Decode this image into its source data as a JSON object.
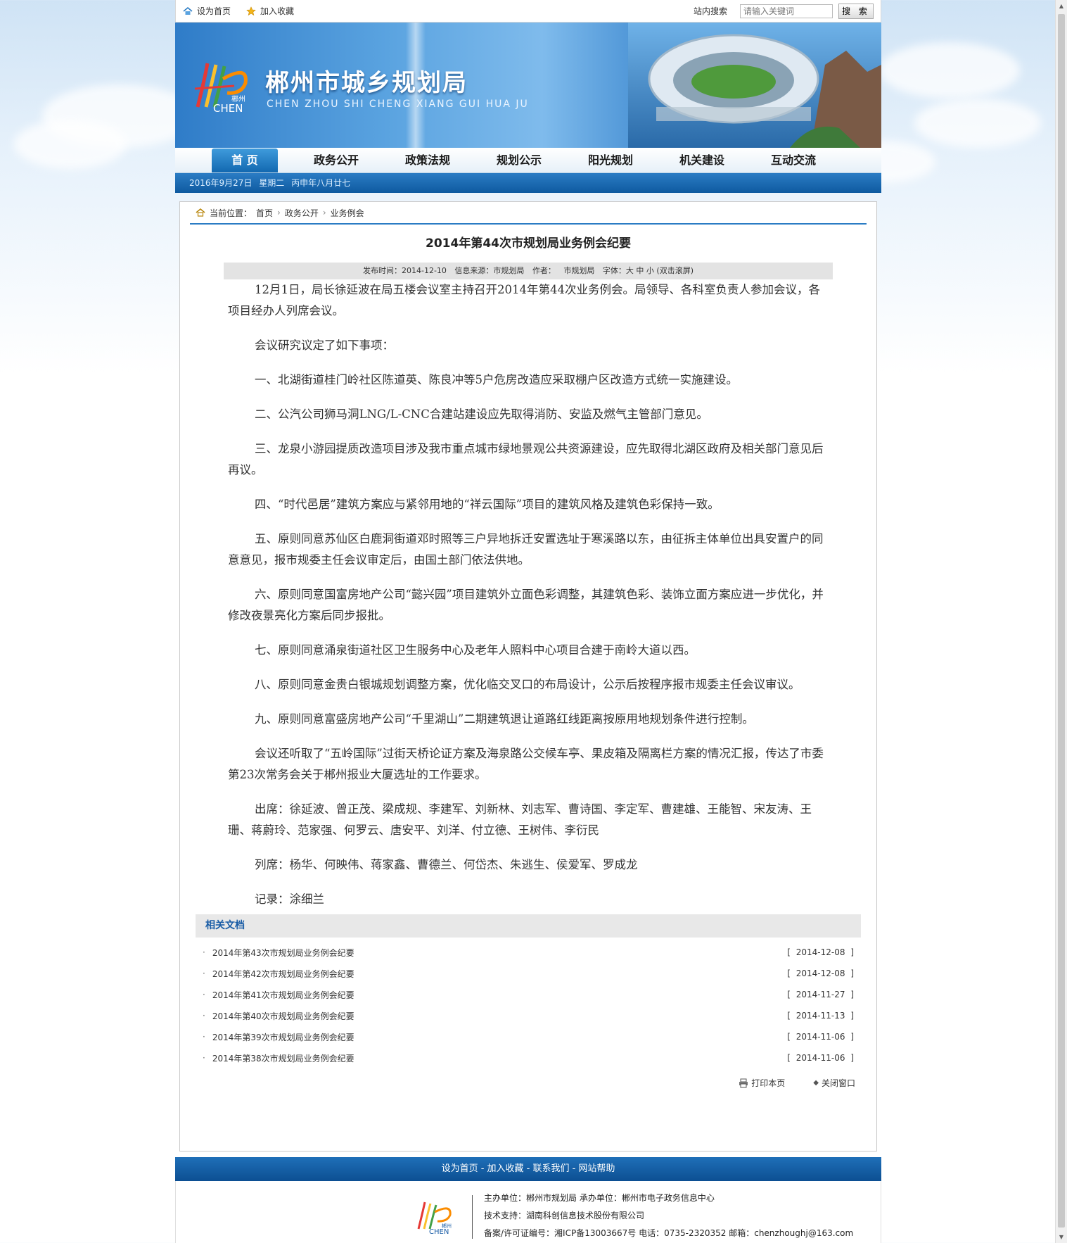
{
  "topbar": {
    "set_home": "设为首页",
    "add_fav": "加入收藏",
    "search_label": "站内搜索",
    "search_placeholder": "请输入关键词",
    "search_button": "搜 索"
  },
  "banner": {
    "title_cn": "郴州市城乡规划局",
    "title_en": "CHEN ZHOU SHI CHENG XIANG GUI HUA JU",
    "logo_text_small": "郴州",
    "logo_text_big": "CHEN"
  },
  "nav": [
    "首 页",
    "政务公开",
    "政策法规",
    "规划公示",
    "阳光规划",
    "机关建设",
    "互动交流"
  ],
  "datebar": "2016年9月27日  星期二  丙申年八月廿七",
  "breadcrumb": {
    "label": "当前位置：",
    "items": [
      "首页",
      "政务公开",
      "业务例会"
    ]
  },
  "article": {
    "title": "2014年第44次市规划局业务例会纪要",
    "meta": {
      "publish": "发布时间：2014-12-10",
      "source": "信息来源：市规划局",
      "author": "作者：",
      "author_val": "市规划局",
      "font": "字体：大 中 小  (双击滚屏)"
    },
    "paragraphs": [
      "12月1日，局长徐延波在局五楼会议室主持召开2014年第44次业务例会。局领导、各科室负责人参加会议，各项目经办人列席会议。",
      "会议研究议定了如下事项：",
      "一、北湖街道桂门岭社区陈道英、陈良冲等5户危房改造应采取棚户区改造方式统一实施建设。",
      "二、公汽公司狮马洞LNG/L-CNC合建站建设应先取得消防、安监及燃气主管部门意见。",
      "三、龙泉小游园提质改造项目涉及我市重点城市绿地景观公共资源建设，应先取得北湖区政府及相关部门意见后再议。",
      "四、“时代邑居”建筑方案应与紧邻用地的“祥云国际”项目的建筑风格及建筑色彩保持一致。",
      "五、原则同意苏仙区白鹿洞街道邓时照等三户异地拆迁安置选址于寒溪路以东，由征拆主体单位出具安置户的同意意见，报市规委主任会议审定后，由国土部门依法供地。",
      "六、原则同意国富房地产公司“懿兴园”项目建筑外立面色彩调整，其建筑色彩、装饰立面方案应进一步优化，并修改夜景亮化方案后同步报批。",
      "七、原则同意涌泉街道社区卫生服务中心及老年人照料中心项目合建于南岭大道以西。",
      "八、原则同意金贵白银城规划调整方案，优化临交叉口的布局设计，公示后按程序报市规委主任会议审议。",
      "九、原则同意富盛房地产公司“千里湖山”二期建筑退让道路红线距离按原用地规划条件进行控制。",
      "会议还听取了“五岭国际”过街天桥论证方案及海泉路公交候车亭、果皮箱及隔离栏方案的情况汇报，传达了市委第23次常务会关于郴州报业大厦选址的工作要求。",
      "出席：徐延波、曾正茂、梁成规、李建军、刘新林、刘志军、曹诗国、李定军、曹建雄、王能智、宋友涛、王珊、蒋蔚玲、范家强、何罗云、唐安平、刘洋、付立德、王树伟、李衍民",
      "列席：杨华、何映伟、蒋家鑫、曹德兰、何岱杰、朱逃生、侯爱军、罗成龙",
      "记录：涂细兰"
    ]
  },
  "related": {
    "heading": "相关文档",
    "items": [
      {
        "title": "2014年第43次市规划局业务例会纪要",
        "date": "[ 2014-12-08 ]"
      },
      {
        "title": "2014年第42次市规划局业务例会纪要",
        "date": "[ 2014-12-08 ]"
      },
      {
        "title": "2014年第41次市规划局业务例会纪要",
        "date": "[ 2014-11-27 ]"
      },
      {
        "title": "2014年第40次市规划局业务例会纪要",
        "date": "[ 2014-11-13 ]"
      },
      {
        "title": "2014年第39次市规划局业务例会纪要",
        "date": "[ 2014-11-06 ]"
      },
      {
        "title": "2014年第38次市规划局业务例会纪要",
        "date": "[ 2014-11-06 ]"
      }
    ]
  },
  "tools": {
    "print": "打印本页",
    "close": "关闭窗口"
  },
  "footer": {
    "links": "设为首页 - 加入收藏 - 联系我们 - 网站帮助",
    "line1": "主办单位：郴州市规划局  承办单位：郴州市电子政务信息中心",
    "line2": "技术支持：湖南科创信息技术股份有限公司",
    "line3": "备案/许可证编号：湘ICP备13003667号 电话：0735-2320352 邮箱：chenzhoughj@163.com"
  },
  "colors": {
    "nav_blue": "#1268b0",
    "accent_blue": "#2b7cc4",
    "link_blue": "#1a5da6"
  }
}
